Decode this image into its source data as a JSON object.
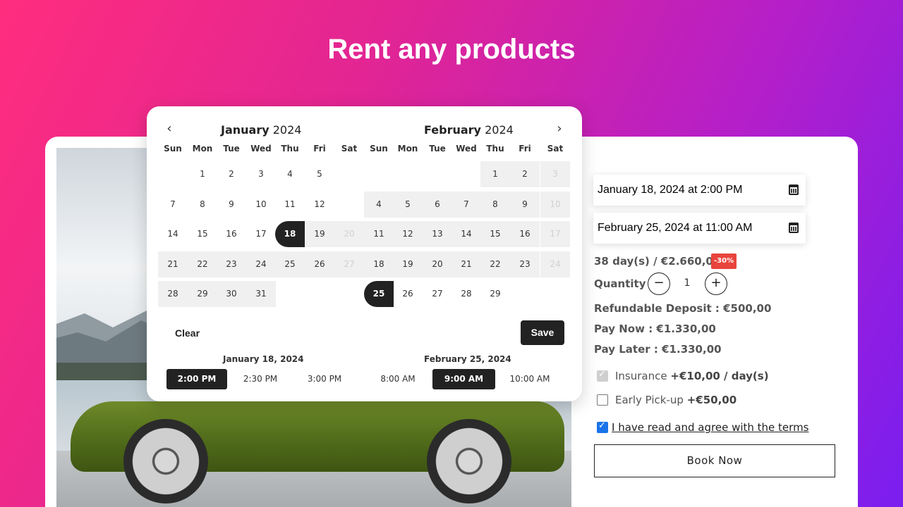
{
  "headline": "Rent any products",
  "calendar": {
    "prev_icon": "chevron-left-icon",
    "next_icon": "chevron-right-icon",
    "months": [
      {
        "month": "January",
        "year": "2024"
      },
      {
        "month": "February",
        "year": "2024"
      }
    ],
    "weekdays": [
      "Sun",
      "Mon",
      "Tue",
      "Wed",
      "Thu",
      "Fri",
      "Sat"
    ],
    "jan_rows": [
      [
        "",
        "1",
        "2",
        "3",
        "4",
        "5",
        ""
      ],
      [
        "7",
        "8",
        "9",
        "10",
        "11",
        "12",
        ""
      ],
      [
        "14",
        "15",
        "16",
        "17",
        "18",
        "19",
        "20"
      ],
      [
        "21",
        "22",
        "23",
        "24",
        "25",
        "26",
        "27"
      ],
      [
        "28",
        "29",
        "30",
        "31",
        "",
        "",
        ""
      ]
    ],
    "feb_rows": [
      [
        "",
        "",
        "",
        "",
        "1",
        "2",
        "3"
      ],
      [
        "4",
        "5",
        "6",
        "7",
        "8",
        "9",
        "10"
      ],
      [
        "11",
        "12",
        "13",
        "14",
        "15",
        "16",
        "17"
      ],
      [
        "18",
        "19",
        "20",
        "21",
        "22",
        "23",
        "24"
      ],
      [
        "25",
        "26",
        "27",
        "28",
        "29",
        "",
        ""
      ]
    ],
    "selected_start": "18",
    "selected_end": "25",
    "clear_label": "Clear",
    "save_label": "Save",
    "start_time_date": "January 18, 2024",
    "end_time_date": "February 25, 2024",
    "start_times": [
      "2:00 PM",
      "2:30 PM",
      "3:00 PM"
    ],
    "end_times": [
      "8:00 AM",
      "9:00 AM",
      "10:00 AM"
    ],
    "selected_start_time": "2:00 PM",
    "selected_end_time": "9:00 AM"
  },
  "form": {
    "start_value": "January 18, 2024 at 2:00 PM",
    "end_value": "February 25, 2024 at 11:00 AM",
    "price": "38 day(s) / €2.660,00",
    "discount": "-30%",
    "quantity_label": "Quantity",
    "quantity_value": "1",
    "deposit": "Refundable Deposit : €500,00",
    "pay_now": "Pay Now : €1.330,00",
    "pay_later": "Pay Later : €1.330,00",
    "insurance_label": "Insurance",
    "insurance_price": "+€10,00 / day(s)",
    "early_label": "Early Pick-up",
    "early_price": "+€50,00",
    "terms": "I have read and agree with the terms",
    "book_label": "Book Now"
  },
  "colors": {
    "accent": "#222222",
    "discount": "#e8453c",
    "checkbox": "#1a73e8"
  }
}
